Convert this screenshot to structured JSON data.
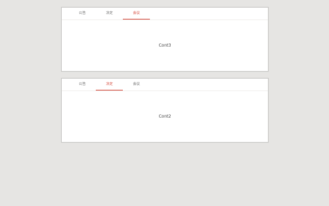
{
  "panels": [
    {
      "tabs": [
        {
          "label": "公告",
          "active": false
        },
        {
          "label": "决定",
          "active": false
        },
        {
          "label": "会议",
          "active": true
        }
      ],
      "content": "Cont3"
    },
    {
      "tabs": [
        {
          "label": "公告",
          "active": false
        },
        {
          "label": "决定",
          "active": true
        },
        {
          "label": "会议",
          "active": false
        }
      ],
      "content": "Cont2"
    }
  ],
  "colors": {
    "background": "#e6e5e3",
    "panel": "#ffffff",
    "accent": "#d6493c",
    "tab_text": "#6a6a6a"
  }
}
